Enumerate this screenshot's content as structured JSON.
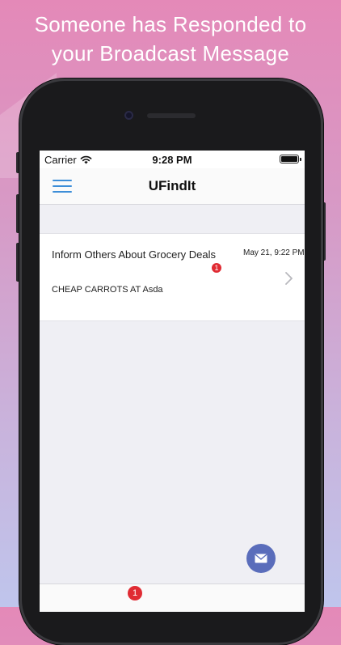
{
  "headline": {
    "line1": "Someone has Responded to",
    "line2": "your Broadcast Message"
  },
  "status_bar": {
    "carrier": "Carrier",
    "time": "9:28 PM"
  },
  "nav": {
    "title": "UFindIt"
  },
  "messages": [
    {
      "title": "Inform Others About Grocery Deals",
      "date": "May 21, 9:22 PM",
      "unread_count": "1",
      "body": "CHEAP CARROTS AT Asda"
    }
  ],
  "tab_bar": {
    "badge": "1"
  },
  "colors": {
    "accent": "#3d8ed8",
    "badge": "#e02b33",
    "fab": "#5a6dbb"
  },
  "icons": {
    "menu": "hamburger-menu-icon",
    "wifi": "wifi-icon",
    "battery": "battery-icon",
    "chevron": "chevron-right-icon",
    "compose": "envelope-icon"
  }
}
